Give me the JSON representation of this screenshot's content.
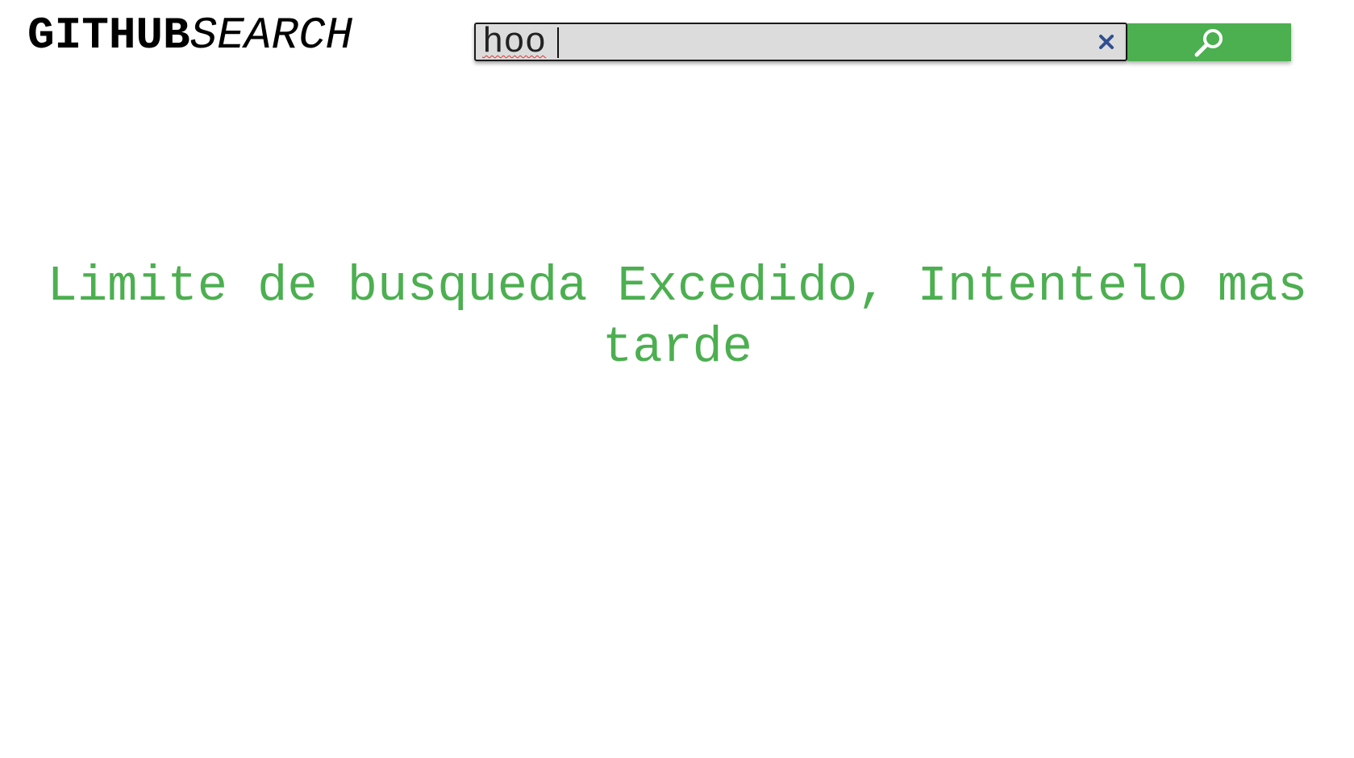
{
  "header": {
    "logo": {
      "bold_text": "GITHUB",
      "italic_text": "SEARCH"
    },
    "search": {
      "value": "hoo",
      "clear_icon": "close-icon",
      "button_icon": "search-icon"
    }
  },
  "main": {
    "message": "Limite de busqueda Excedido, Intentelo mas tarde"
  },
  "colors": {
    "accent": "#4caf50",
    "input_background": "#dcdcdc",
    "clear_icon": "#2f4f8f",
    "text": "#000000"
  }
}
